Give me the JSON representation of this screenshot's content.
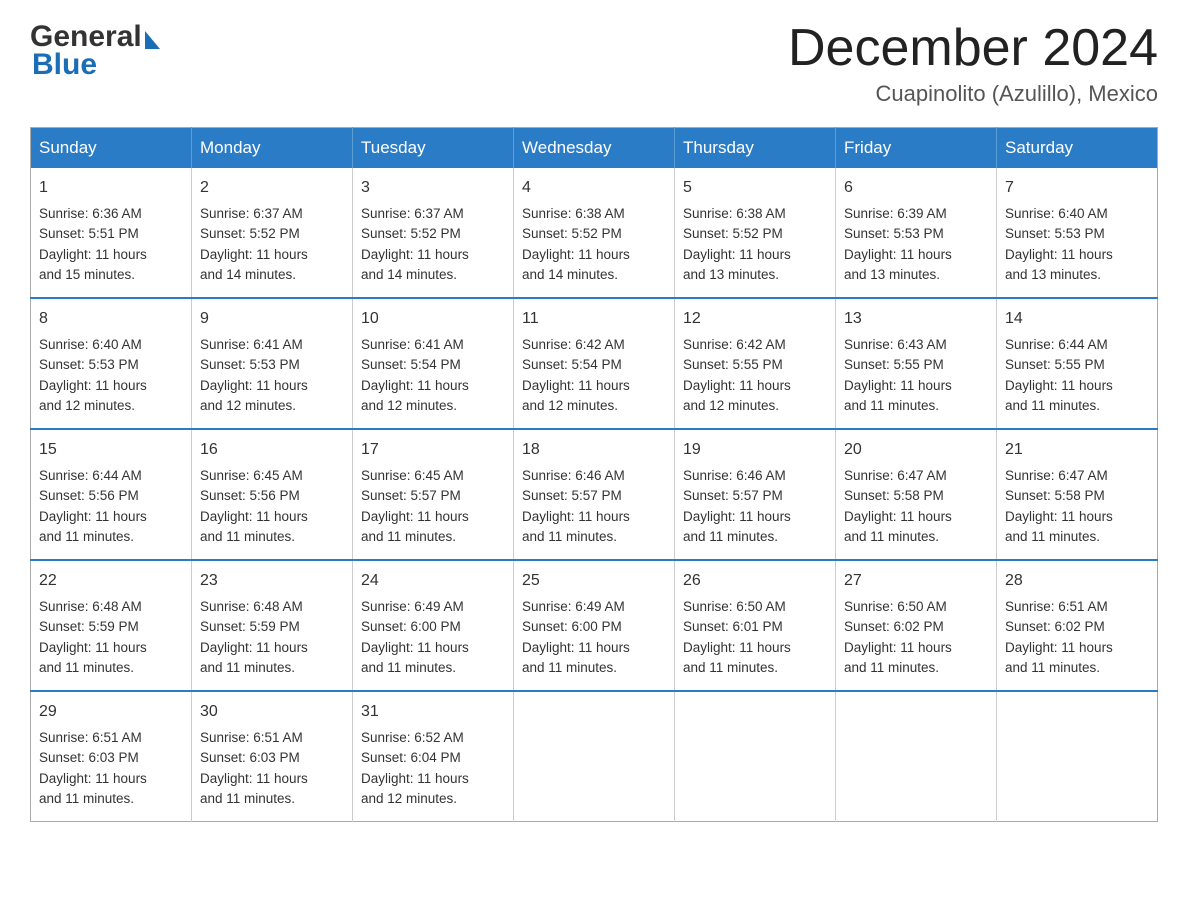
{
  "header": {
    "logo_general": "General",
    "logo_blue": "Blue",
    "month_title": "December 2024",
    "location": "Cuapinolito (Azulillo), Mexico"
  },
  "weekdays": [
    "Sunday",
    "Monday",
    "Tuesday",
    "Wednesday",
    "Thursday",
    "Friday",
    "Saturday"
  ],
  "weeks": [
    [
      {
        "day": "1",
        "sunrise": "6:36 AM",
        "sunset": "5:51 PM",
        "daylight": "11 hours and 15 minutes."
      },
      {
        "day": "2",
        "sunrise": "6:37 AM",
        "sunset": "5:52 PM",
        "daylight": "11 hours and 14 minutes."
      },
      {
        "day": "3",
        "sunrise": "6:37 AM",
        "sunset": "5:52 PM",
        "daylight": "11 hours and 14 minutes."
      },
      {
        "day": "4",
        "sunrise": "6:38 AM",
        "sunset": "5:52 PM",
        "daylight": "11 hours and 14 minutes."
      },
      {
        "day": "5",
        "sunrise": "6:38 AM",
        "sunset": "5:52 PM",
        "daylight": "11 hours and 13 minutes."
      },
      {
        "day": "6",
        "sunrise": "6:39 AM",
        "sunset": "5:53 PM",
        "daylight": "11 hours and 13 minutes."
      },
      {
        "day": "7",
        "sunrise": "6:40 AM",
        "sunset": "5:53 PM",
        "daylight": "11 hours and 13 minutes."
      }
    ],
    [
      {
        "day": "8",
        "sunrise": "6:40 AM",
        "sunset": "5:53 PM",
        "daylight": "11 hours and 12 minutes."
      },
      {
        "day": "9",
        "sunrise": "6:41 AM",
        "sunset": "5:53 PM",
        "daylight": "11 hours and 12 minutes."
      },
      {
        "day": "10",
        "sunrise": "6:41 AM",
        "sunset": "5:54 PM",
        "daylight": "11 hours and 12 minutes."
      },
      {
        "day": "11",
        "sunrise": "6:42 AM",
        "sunset": "5:54 PM",
        "daylight": "11 hours and 12 minutes."
      },
      {
        "day": "12",
        "sunrise": "6:42 AM",
        "sunset": "5:55 PM",
        "daylight": "11 hours and 12 minutes."
      },
      {
        "day": "13",
        "sunrise": "6:43 AM",
        "sunset": "5:55 PM",
        "daylight": "11 hours and 11 minutes."
      },
      {
        "day": "14",
        "sunrise": "6:44 AM",
        "sunset": "5:55 PM",
        "daylight": "11 hours and 11 minutes."
      }
    ],
    [
      {
        "day": "15",
        "sunrise": "6:44 AM",
        "sunset": "5:56 PM",
        "daylight": "11 hours and 11 minutes."
      },
      {
        "day": "16",
        "sunrise": "6:45 AM",
        "sunset": "5:56 PM",
        "daylight": "11 hours and 11 minutes."
      },
      {
        "day": "17",
        "sunrise": "6:45 AM",
        "sunset": "5:57 PM",
        "daylight": "11 hours and 11 minutes."
      },
      {
        "day": "18",
        "sunrise": "6:46 AM",
        "sunset": "5:57 PM",
        "daylight": "11 hours and 11 minutes."
      },
      {
        "day": "19",
        "sunrise": "6:46 AM",
        "sunset": "5:57 PM",
        "daylight": "11 hours and 11 minutes."
      },
      {
        "day": "20",
        "sunrise": "6:47 AM",
        "sunset": "5:58 PM",
        "daylight": "11 hours and 11 minutes."
      },
      {
        "day": "21",
        "sunrise": "6:47 AM",
        "sunset": "5:58 PM",
        "daylight": "11 hours and 11 minutes."
      }
    ],
    [
      {
        "day": "22",
        "sunrise": "6:48 AM",
        "sunset": "5:59 PM",
        "daylight": "11 hours and 11 minutes."
      },
      {
        "day": "23",
        "sunrise": "6:48 AM",
        "sunset": "5:59 PM",
        "daylight": "11 hours and 11 minutes."
      },
      {
        "day": "24",
        "sunrise": "6:49 AM",
        "sunset": "6:00 PM",
        "daylight": "11 hours and 11 minutes."
      },
      {
        "day": "25",
        "sunrise": "6:49 AM",
        "sunset": "6:00 PM",
        "daylight": "11 hours and 11 minutes."
      },
      {
        "day": "26",
        "sunrise": "6:50 AM",
        "sunset": "6:01 PM",
        "daylight": "11 hours and 11 minutes."
      },
      {
        "day": "27",
        "sunrise": "6:50 AM",
        "sunset": "6:02 PM",
        "daylight": "11 hours and 11 minutes."
      },
      {
        "day": "28",
        "sunrise": "6:51 AM",
        "sunset": "6:02 PM",
        "daylight": "11 hours and 11 minutes."
      }
    ],
    [
      {
        "day": "29",
        "sunrise": "6:51 AM",
        "sunset": "6:03 PM",
        "daylight": "11 hours and 11 minutes."
      },
      {
        "day": "30",
        "sunrise": "6:51 AM",
        "sunset": "6:03 PM",
        "daylight": "11 hours and 11 minutes."
      },
      {
        "day": "31",
        "sunrise": "6:52 AM",
        "sunset": "6:04 PM",
        "daylight": "11 hours and 12 minutes."
      },
      null,
      null,
      null,
      null
    ]
  ],
  "labels": {
    "sunrise": "Sunrise:",
    "sunset": "Sunset:",
    "daylight": "Daylight:"
  }
}
